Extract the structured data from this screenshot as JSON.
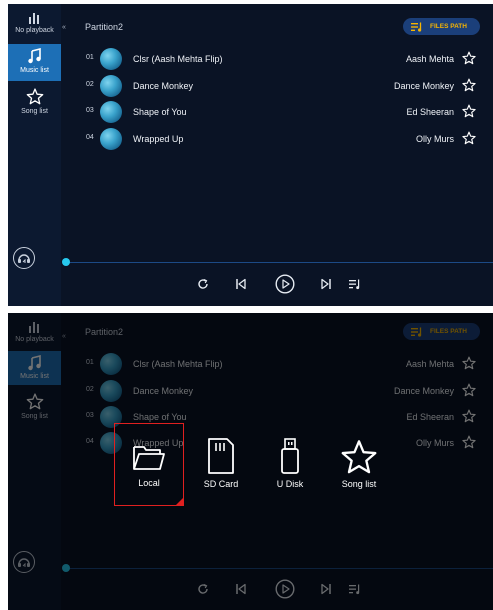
{
  "sidebar": {
    "no_playback_label": "No playback",
    "music_list_label": "Music list",
    "song_list_label": "Song list"
  },
  "header": {
    "collapse_glyph": "«",
    "partition": "Partition2",
    "files_path_label": "FILES PATH"
  },
  "songs": [
    {
      "num": "01",
      "title": "Clsr (Aash Mehta Flip)",
      "artist": "Aash Mehta"
    },
    {
      "num": "02",
      "title": "Dance Monkey",
      "artist": "Dance Monkey"
    },
    {
      "num": "03",
      "title": "Shape of You",
      "artist": "Ed Sheeran"
    },
    {
      "num": "04",
      "title": "Wrapped Up",
      "artist": "Olly Murs"
    }
  ],
  "sources": {
    "local_label": "Local",
    "sd_card_label": "SD Card",
    "udisk_label": "U Disk",
    "song_list_label": "Song list"
  },
  "colors": {
    "accent": "#1d6fb6",
    "highlight_text": "#f7b500",
    "selection_border": "#e02020",
    "progress_knob": "#27c8ee"
  },
  "icons": [
    "equalizer-icon",
    "music-note-icon",
    "star-icon",
    "headset-icon",
    "files-path-icon",
    "repeat-icon",
    "previous-icon",
    "play-icon",
    "next-icon",
    "playlist-icon",
    "folder-icon",
    "sd-card-icon",
    "usb-disk-icon"
  ]
}
